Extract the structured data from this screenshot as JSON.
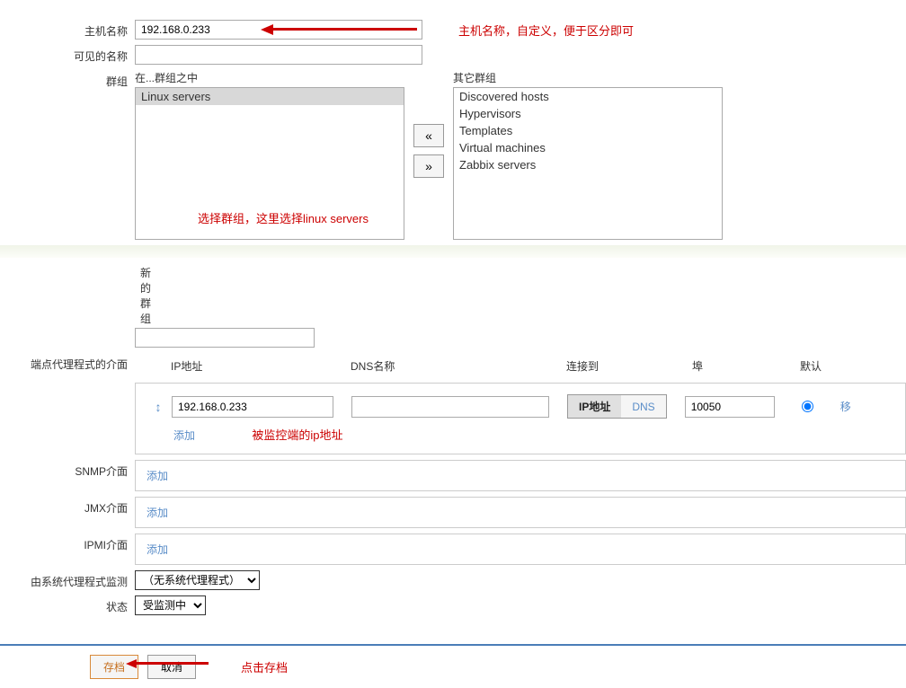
{
  "labels": {
    "hostname": "主机名称",
    "visible_name": "可见的名称",
    "groups": "群组",
    "in_groups": "在...群组之中",
    "other_groups": "其它群组",
    "new_group": "新的群组",
    "agent_interfaces": "端点代理程式的介面",
    "snmp_interfaces": "SNMP介面",
    "jmx_interfaces": "JMX介面",
    "ipmi_interfaces": "IPMI介面",
    "monitored_by": "由系统代理程式监测",
    "status": "状态"
  },
  "values": {
    "hostname": "192.168.0.233",
    "visible_name": "",
    "new_group": "",
    "agent_ip": "192.168.0.233",
    "agent_dns": "",
    "agent_port": "10050"
  },
  "groups_in": [
    "Linux servers"
  ],
  "groups_other": [
    "Discovered hosts",
    "Hypervisors",
    "Templates",
    "Virtual machines",
    "Zabbix servers"
  ],
  "columns": {
    "ip": "IP地址",
    "dns": "DNS名称",
    "connect_to": "连接到",
    "port": "埠",
    "default": "默认",
    "remove": "移"
  },
  "toggles": {
    "ip": "IP地址",
    "dns": "DNS"
  },
  "actions": {
    "add": "添加",
    "move_left": "«",
    "move_right": "»",
    "save": "存档",
    "cancel": "取消"
  },
  "selects": {
    "monitored_by": "（无系统代理程式）",
    "status": "受监测中"
  },
  "annotations": {
    "hostname": "主机名称，自定义，便于区分即可",
    "groups": "选择群组，这里选择linux servers",
    "ip": "被监控端的ip地址",
    "save": "点击存档"
  }
}
